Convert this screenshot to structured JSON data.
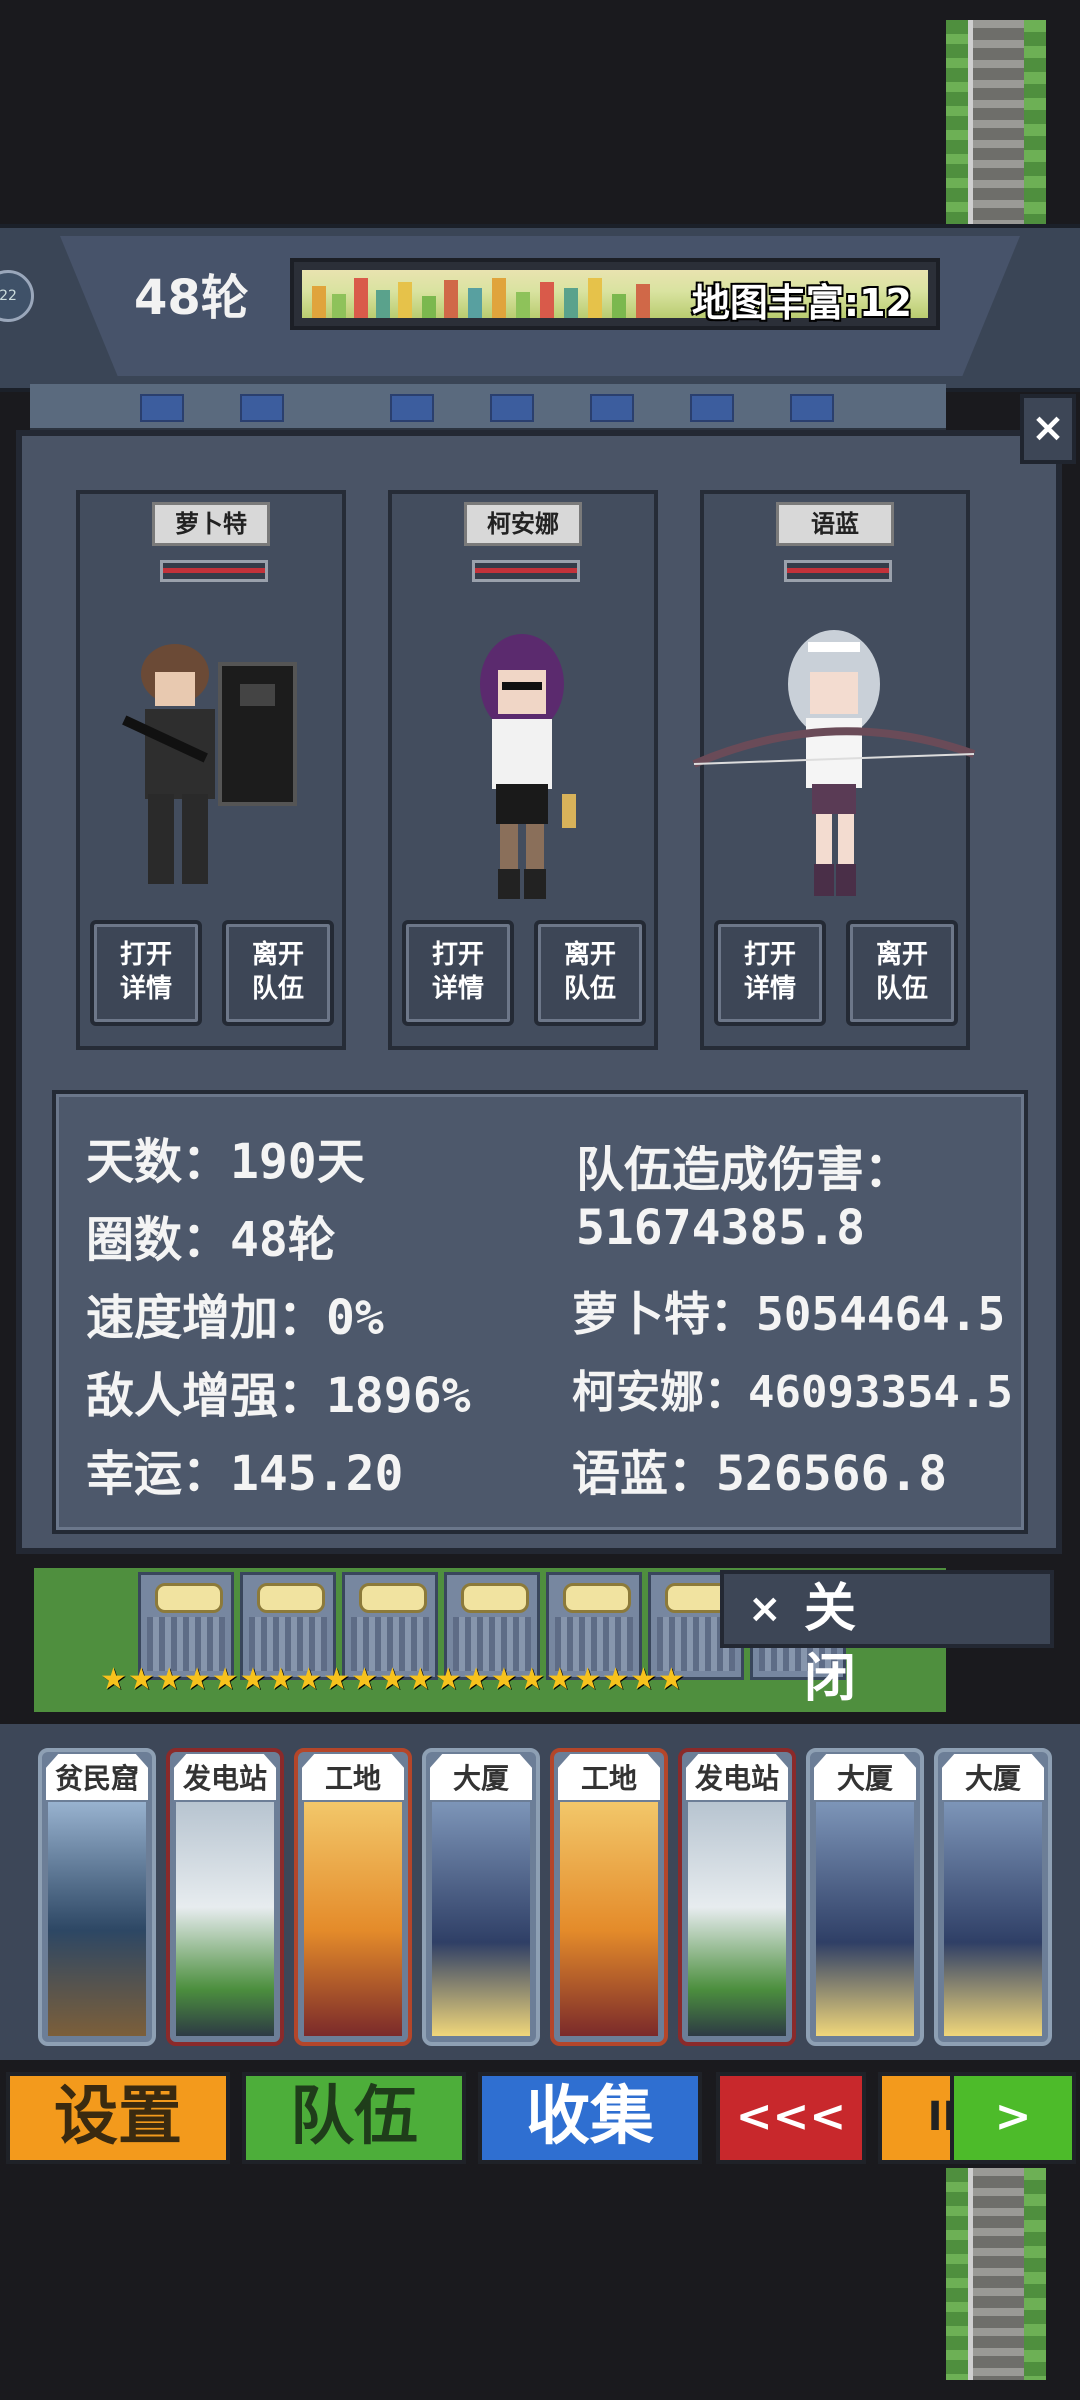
{
  "header": {
    "round": "48轮",
    "map_richness": "地图丰富:12",
    "orb_text": "22"
  },
  "party": [
    {
      "name": "萝卜特",
      "open_label": [
        "打开",
        "详情"
      ],
      "leave_label": [
        "离开",
        "队伍"
      ]
    },
    {
      "name": "柯安娜",
      "open_label": [
        "打开",
        "详情"
      ],
      "leave_label": [
        "离开",
        "队伍"
      ]
    },
    {
      "name": "语蓝",
      "open_label": [
        "打开",
        "详情"
      ],
      "leave_label": [
        "离开",
        "队伍"
      ]
    }
  ],
  "stats": {
    "days": "天数：190天",
    "rounds": "圈数：48轮",
    "speed": "速度增加：0%",
    "enemy": "敌人增强：1896%",
    "luck": "幸运：145.20",
    "team_damage_label": "队伍造成伤害：",
    "team_damage_value": "51674385.8",
    "member1_damage": "萝卜特：5054464.5",
    "member2_damage": "柯安娜：46093354.5",
    "member3_damage": "语蓝：526566.8"
  },
  "close_dialog": {
    "x": "×",
    "label": "关 闭"
  },
  "close_icon": "×",
  "cards": [
    {
      "label": "贫民窟",
      "color": "blue"
    },
    {
      "label": "发电站",
      "color": "red"
    },
    {
      "label": "工地",
      "color": "orange"
    },
    {
      "label": "大厦",
      "color": "blue"
    },
    {
      "label": "工地",
      "color": "orange"
    },
    {
      "label": "发电站",
      "color": "red"
    },
    {
      "label": "大厦",
      "color": "blue"
    },
    {
      "label": "大厦",
      "color": "blue"
    }
  ],
  "buttons": {
    "settings": "设置",
    "team": "队伍",
    "collect": "收集",
    "rewind": "<<<",
    "pause": "III",
    "play": ">"
  },
  "colors": {
    "settings": "#f39a1c",
    "team": "#4dae3a",
    "collect": "#2f6fd1",
    "rewind": "#c8282c",
    "pause": "#f39a1c",
    "play": "#4dbb2a"
  }
}
